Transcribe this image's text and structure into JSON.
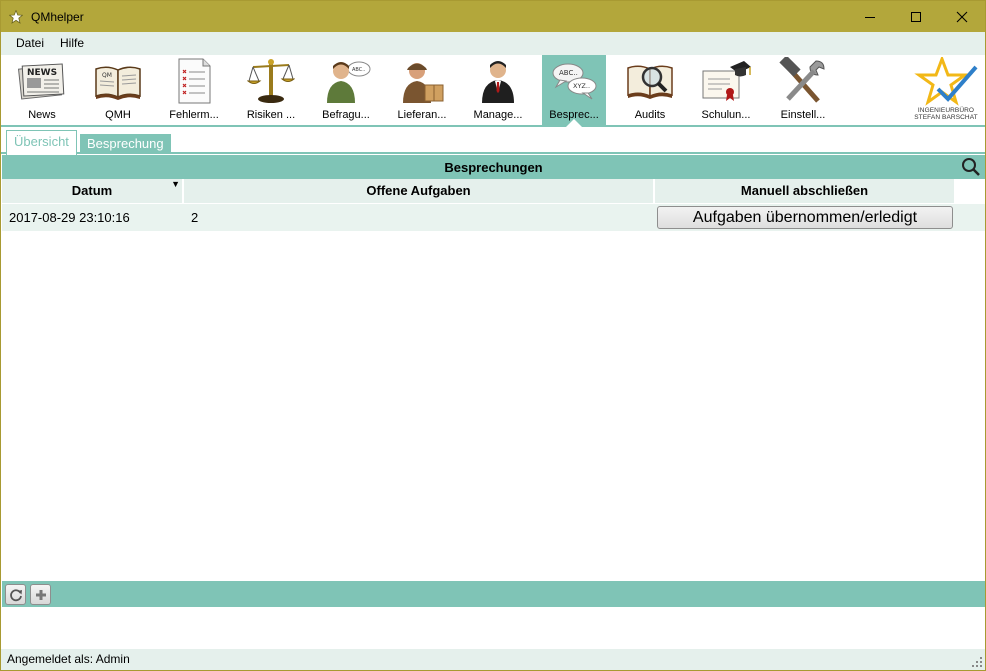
{
  "window": {
    "title": "QMhelper",
    "icon": "star-icon",
    "controls": [
      "minimize-icon",
      "maximize-icon",
      "close-icon"
    ]
  },
  "menu": {
    "items": [
      {
        "label": "Datei"
      },
      {
        "label": "Hilfe"
      }
    ]
  },
  "ribbon": {
    "items": [
      {
        "label": "News",
        "icon": "newspaper-icon"
      },
      {
        "label": "QMH",
        "icon": "book-icon"
      },
      {
        "label": "Fehlerm...",
        "icon": "checklist-icon"
      },
      {
        "label": "Risiken ...",
        "icon": "scales-icon"
      },
      {
        "label": "Befragu...",
        "icon": "survey-person-icon"
      },
      {
        "label": "Lieferan...",
        "icon": "delivery-person-icon"
      },
      {
        "label": "Manage...",
        "icon": "manager-icon"
      },
      {
        "label": "Besprec...",
        "icon": "speech-bubbles-icon",
        "active": true
      },
      {
        "label": "Audits",
        "icon": "magnifier-book-icon"
      },
      {
        "label": "Schulun...",
        "icon": "certificate-icon"
      },
      {
        "label": "Einstell...",
        "icon": "tools-icon"
      }
    ],
    "logo_line1": "INGENIEURBÜRO",
    "logo_line2": "STEFAN BARSCHAT"
  },
  "tabs": [
    {
      "label": "Übersicht",
      "active": true
    },
    {
      "label": "Besprechung",
      "active": false
    }
  ],
  "panel": {
    "title": "Besprechungen",
    "search_icon": "search-icon"
  },
  "grid": {
    "columns": [
      "Datum",
      "Offene Aufgaben",
      "Manuell abschließen"
    ],
    "sort_indicator": "▼",
    "rows": [
      {
        "datum": "2017-08-29 23:10:16",
        "offene_aufgaben": "2",
        "action_label": "Aufgaben übernommen/erledigt"
      }
    ]
  },
  "bottom_toolbar": {
    "buttons": [
      "refresh-icon",
      "add-icon"
    ]
  },
  "status": {
    "text": "Angemeldet als: Admin"
  },
  "colors": {
    "titlebar": "#b3a73b",
    "accent": "#7fc4b6",
    "light": "#e5f0ec"
  }
}
